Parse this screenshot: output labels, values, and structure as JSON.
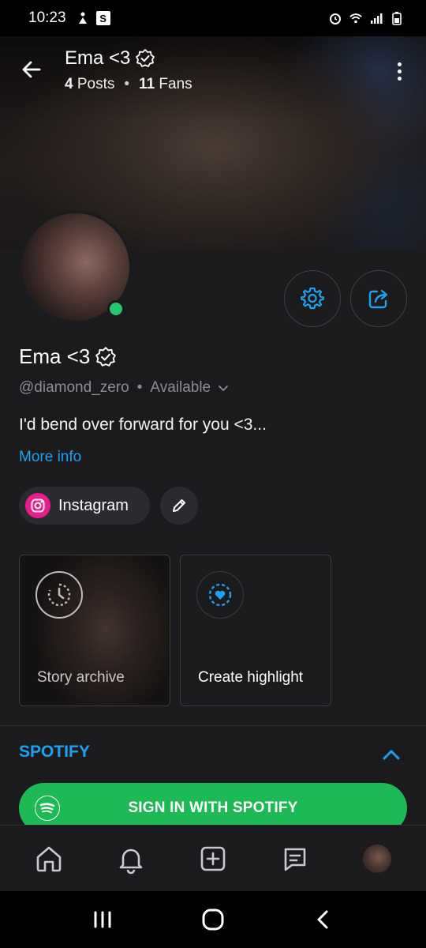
{
  "status_bar": {
    "time": "10:23",
    "left_icons": [
      "figure-icon",
      "s-app-icon"
    ],
    "s_badge": "S",
    "right_icons": [
      "alarm-icon",
      "wifi-icon",
      "signal-icon",
      "battery-icon"
    ]
  },
  "header": {
    "name": "Ema <3",
    "posts_count": "4",
    "posts_label": "Posts",
    "fans_count": "11",
    "fans_label": "Fans",
    "separator": "•"
  },
  "profile": {
    "name": "Ema <3",
    "handle": "@diamond_zero",
    "separator": "•",
    "availability": "Available",
    "bio": "I'd bend over forward for you <3...",
    "more_info": "More info",
    "online": true
  },
  "socials": [
    {
      "label": "Instagram",
      "icon": "instagram-icon"
    }
  ],
  "highlights": {
    "story_archive": "Story archive",
    "create_highlight": "Create highlight"
  },
  "spotify": {
    "title": "SPOTIFY",
    "button": "SIGN IN WITH SPOTIFY"
  },
  "bottom_nav": [
    "home-icon",
    "bell-icon",
    "add-icon",
    "messages-icon",
    "profile-avatar"
  ],
  "system_nav": [
    "recents-icon",
    "home-circle-icon",
    "back-chevron-icon"
  ],
  "colors": {
    "accent": "#1ea1f2",
    "background": "#1b1b1d",
    "spotify_green": "#1db954",
    "online": "#28c76f",
    "instagram": "#e91e8a"
  }
}
